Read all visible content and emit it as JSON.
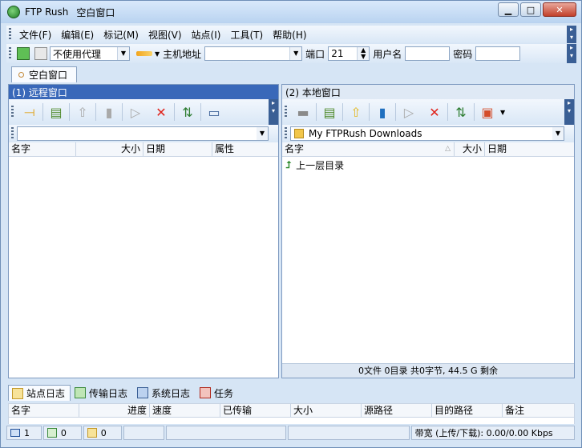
{
  "window": {
    "app_name": "FTP Rush",
    "doc_title": "空白窗口"
  },
  "menu": [
    "文件(F)",
    "编辑(E)",
    "标记(M)",
    "视图(V)",
    "站点(I)",
    "工具(T)",
    "帮助(H)"
  ],
  "toolbar": {
    "proxy_value": "不使用代理",
    "host_label": "主机地址",
    "host_value": "",
    "port_label": "端口",
    "port_value": "21",
    "user_label": "用户名",
    "user_value": "",
    "pass_label": "密码",
    "pass_value": ""
  },
  "tabs": [
    {
      "label": "空白窗口",
      "active": true
    }
  ],
  "remote": {
    "title": "(1) 远程窗口",
    "path": "",
    "columns": [
      "名字",
      "大小",
      "日期",
      "属性"
    ]
  },
  "local": {
    "title": "(2) 本地窗口",
    "path": "My FTPRush Downloads",
    "columns": [
      "名字",
      "大小",
      "日期"
    ],
    "rows": [
      {
        "name": "上一层目录"
      }
    ],
    "status": "0文件 0目录 共0字节, 44.5 G 剩余"
  },
  "log_tabs": [
    "站点日志",
    "传输日志",
    "系统日志",
    "任务"
  ],
  "task_columns": [
    "名字",
    "进度",
    "速度",
    "已传输",
    "大小",
    "源路径",
    "目的路径",
    "备注"
  ],
  "statusbar": {
    "count1": "1",
    "count2": "0",
    "count3": "0",
    "bandwidth": "带宽 (上传/下载): 0.00/0.00 Kbps"
  },
  "colors": {
    "accent": "#3968b9",
    "window_bg": "#d6e5f5",
    "close_red": "#c2402a"
  }
}
